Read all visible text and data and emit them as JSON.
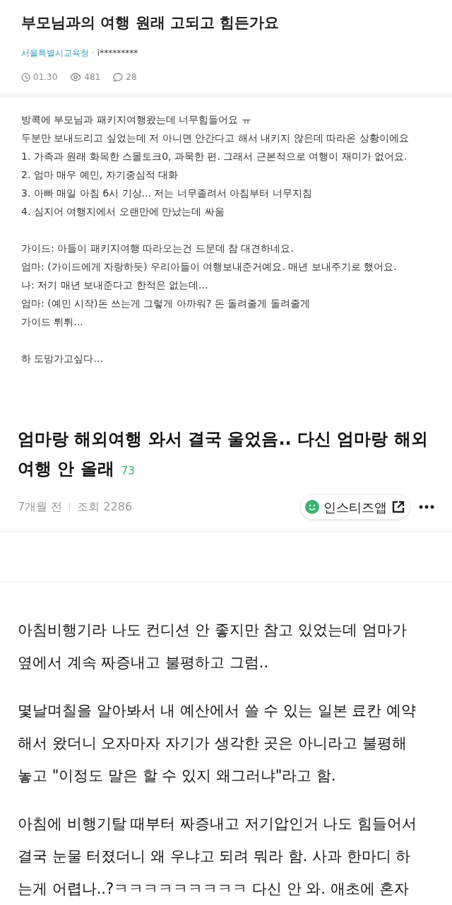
{
  "post": {
    "title": "부모님과의 여행 원래 고되고 힘든가요",
    "board": "서울특별시교육청",
    "separator": "·",
    "author": "i*********",
    "date": "01.30",
    "views": "481",
    "comments": "28",
    "body": [
      [
        "방콕에 부모님과 패키지여행왔는데 너무힘들어요 ㅠ",
        "두분만 보내드리고 싶었는데 저 아니면 안간다고 해서 내키지 않은데 따라온 상황이에요",
        "1. 가족과 원래 화목한 스몰토크0, 과묵한 편. 그래서 근본적으로 여행이 재미가 없어요.",
        "2. 엄마 매우 예민, 자기중심적 대화",
        "3. 아빠 매일 아침 6시 기상... 저는 너무졸려서 아침부터 너무지침",
        "4. 심지어 여행지에서 오랜만에 만났는데 싸움"
      ],
      [
        "가이드: 아들이 패키지여행 따라오는건 드문데 참 대견하네요.",
        "엄마: (가이드에게 자랑하듯) 우리아들이 여행보내준거예요. 매년 보내주기로 했어요.",
        "나: 저기 매년 보내준다고 한적은 없는데...",
        "엄마: (예민 시작)돈 쓰는게 그렇게 아까워? 돈 돌려줄게 돌려줄게",
        "가이드 튀튀..."
      ],
      [
        "하 도망가고싶다..."
      ]
    ]
  },
  "article": {
    "title_lines": [
      "엄마랑 해외여행 와서 결국 울었음.. 다신 엄마랑 해외",
      "여행 안 올래"
    ],
    "comment_count": "73",
    "time": "7개월 전",
    "views": "조회 2286",
    "app_button": "인스티즈앱",
    "paragraphs": [
      "아침비행기라 나도 컨디션 안 좋지만 참고 있었는데 엄마가 옆에서 계속 짜증내고 불평하고 그럼..",
      "몇날며칠을 알아봐서 내 예산에서 쓸 수 있는 일본 료칸 예약해서 왔더니 오자마자 자기가 생각한 곳은 아니라고 불평해놓고 \"이정도 말은 할 수 있지 왜그러냐\"라고 함.",
      "아침에 비행기탈 때부터 짜증내고 저기압인거 나도 힘들어서 결국 눈물 터졌더니 왜 우냐고 되려 뭐라 함. 사과 한마디 하는게 어렵나..?ㅋㅋㅋㅋㅋㅋㅋㅋㅋ 다신 안 와. 애초에 혼자"
    ]
  }
}
